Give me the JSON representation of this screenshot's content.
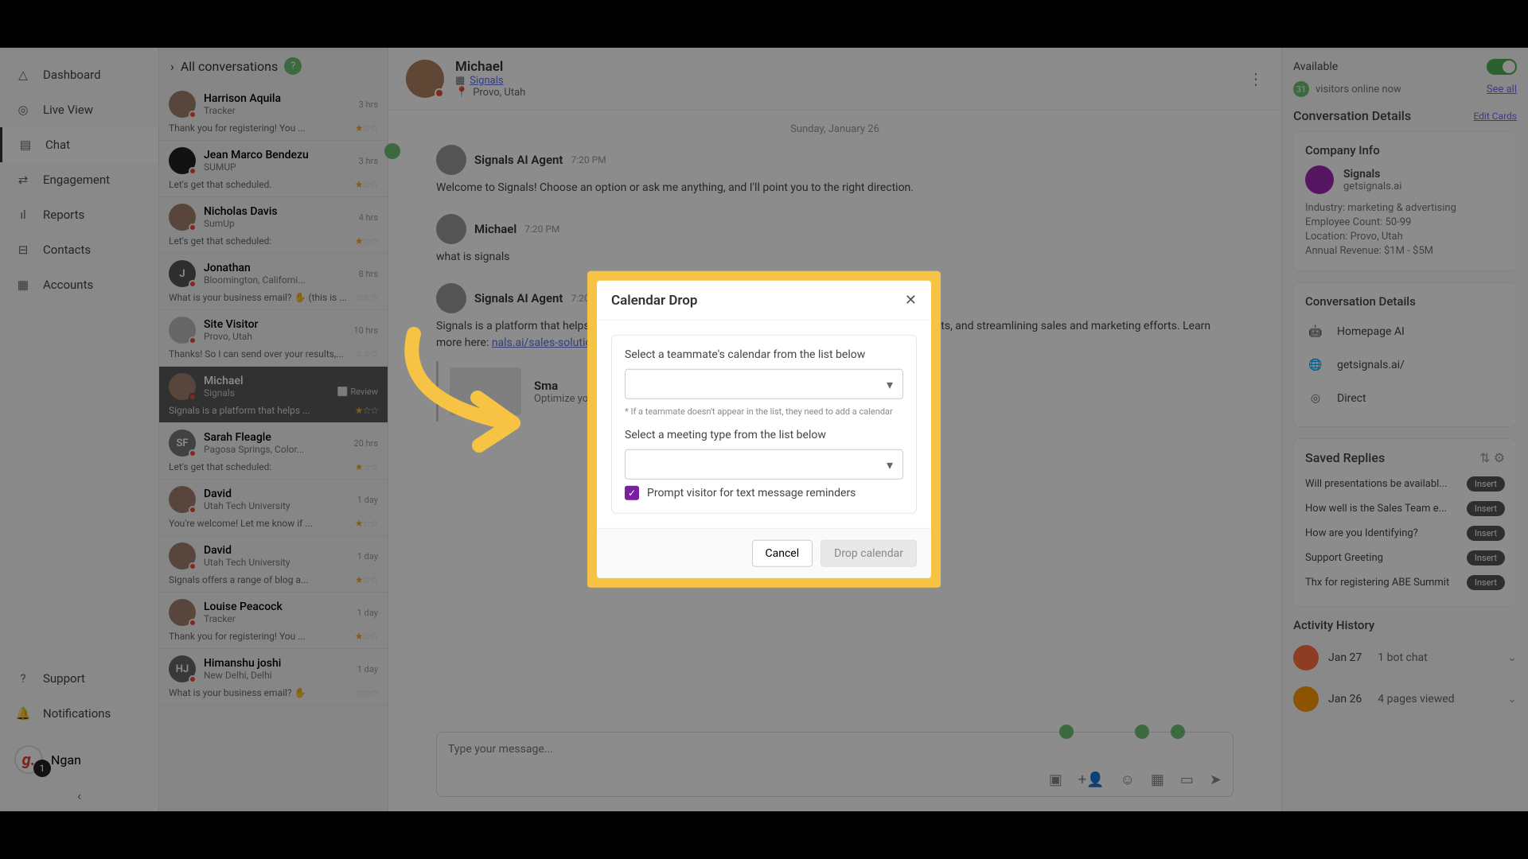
{
  "nav": {
    "items": [
      {
        "label": "Dashboard",
        "icon": "△"
      },
      {
        "label": "Live View",
        "icon": "◎"
      },
      {
        "label": "Chat",
        "icon": "▤",
        "active": true
      },
      {
        "label": "Engagement",
        "icon": "⇄"
      },
      {
        "label": "Reports",
        "icon": "ıl"
      },
      {
        "label": "Contacts",
        "icon": "⊟"
      },
      {
        "label": "Accounts",
        "icon": "▦"
      }
    ],
    "bottom": [
      {
        "label": "Support",
        "icon": "?"
      },
      {
        "label": "Notifications",
        "icon": "🔔"
      }
    ],
    "user": {
      "name": "Ngan",
      "initial": "g.",
      "badge": "1"
    }
  },
  "convoHeader": {
    "title": "All conversations"
  },
  "conversations": [
    {
      "name": "Harrison Aquila",
      "sub": "Tracker",
      "time": "3 hrs",
      "preview": "Thank you for registering! You ...",
      "stars": 1
    },
    {
      "name": "Jean Marco Bendezu",
      "sub": "SUMUP",
      "time": "3 hrs",
      "preview": "Let's get that scheduled.",
      "stars": 1,
      "avatarBg": "#222"
    },
    {
      "name": "Nicholas Davis",
      "sub": "SumUp",
      "time": "4 hrs",
      "preview": "Let's get that scheduled:",
      "stars": 1
    },
    {
      "name": "Jonathan",
      "sub": "Bloomington, Californi...",
      "time": "8 hrs",
      "preview": "What is your business email? ✋ (this is ...",
      "stars": 0,
      "initial": "J",
      "avatarBg": "#555"
    },
    {
      "name": "Site Visitor",
      "sub": "Provo, Utah",
      "time": "10 hrs",
      "preview": "Thanks! So I can send over your results,...",
      "stars": 0,
      "avatarBg": "#bbb"
    },
    {
      "name": "Michael",
      "sub": "Signals",
      "time": "",
      "preview": "Signals is a platform that helps ...",
      "stars": 1,
      "selected": true,
      "badge": "⬜ Review"
    },
    {
      "name": "Sarah Fleagle",
      "sub": "Pagosa Springs, Color...",
      "time": "20 hrs",
      "preview": "Let's get that scheduled:",
      "stars": 1,
      "initial": "SF",
      "avatarBg": "#777"
    },
    {
      "name": "David",
      "sub": "Utah Tech University",
      "time": "1 day",
      "preview": "You're welcome! Let me know if ...",
      "stars": 1
    },
    {
      "name": "David",
      "sub": "Utah Tech University",
      "time": "1 day",
      "preview": "Signals offers a range of blog a...",
      "stars": 1
    },
    {
      "name": "Louise Peacock",
      "sub": "Tracker",
      "time": "1 day",
      "preview": "Thank you for registering! You ...",
      "stars": 1
    },
    {
      "name": "Himanshu joshi",
      "sub": "New Delhi, Delhi",
      "time": "1 day",
      "preview": "What is your business email? ✋",
      "stars": 0,
      "initial": "HJ",
      "avatarBg": "#666"
    }
  ],
  "chat": {
    "header": {
      "name": "Michael",
      "org": "Signals",
      "loc": "Provo, Utah"
    },
    "date": "Sunday, January 26",
    "messages": [
      {
        "author": "Signals AI Agent",
        "time": "7:20 PM",
        "text": "Welcome to Signals! Choose an option or ask me anything, and I'll point you to the right direction."
      },
      {
        "author": "Michael",
        "time": "7:20 PM",
        "text": "what is signals"
      },
      {
        "author": "Signals AI Agent",
        "time": "7:20 PM",
        "text": "Signals is a platform that helps businesses by identifying anonymous website visitors, providing insights, and streamlining sales and marketing efforts. Learn more here: ",
        "link": "nals.ai/sales-solutions",
        "suffix": ")."
      }
    ],
    "card": {
      "title": "Sma",
      "desc": "Optimize your B2B sal... ds, nu"
    },
    "composer": {
      "placeholder": "Type your message..."
    }
  },
  "right": {
    "available": "Available",
    "visitors": {
      "count": "31",
      "text": "visitors online now",
      "link": "See all"
    },
    "detailsTitle": "Conversation Details",
    "editCards": "Edit Cards",
    "company": {
      "title": "Company Info",
      "name": "Signals",
      "domain": "getsignals.ai",
      "meta": [
        {
          "k": "Industry",
          "v": "marketing & advertising"
        },
        {
          "k": "Employee Count",
          "v": "50-99"
        },
        {
          "k": "Location",
          "v": "Provo, Utah"
        },
        {
          "k": "Annual Revenue",
          "v": "$1M - $5M"
        }
      ]
    },
    "details": {
      "title": "Conversation Details",
      "rows": [
        {
          "icon": "🤖",
          "text": "Homepage AI"
        },
        {
          "icon": "🌐",
          "text": "getsignals.ai/"
        },
        {
          "icon": "◎",
          "text": "Direct"
        }
      ]
    },
    "replies": {
      "title": "Saved Replies",
      "items": [
        "Will presentations be availabl...",
        "How well is the Sales Team e...",
        "How are you Identifying?",
        "Support Greeting",
        "Thx for registering ABE Summit"
      ],
      "btn": "Insert"
    },
    "activity": {
      "title": "Activity History",
      "rows": [
        {
          "date": "Jan 27",
          "text": "1 bot chat"
        },
        {
          "date": "Jan 26",
          "text": "4 pages viewed"
        }
      ]
    }
  },
  "modal": {
    "title": "Calendar Drop",
    "label1": "Select a teammate's calendar from the list below",
    "hint": "* If a teammate doesn't appear in the list, they need to add a calendar",
    "label2": "Select a meeting type from the list below",
    "checkbox": "Prompt visitor for text message reminders",
    "cancel": "Cancel",
    "submit": "Drop calendar"
  }
}
